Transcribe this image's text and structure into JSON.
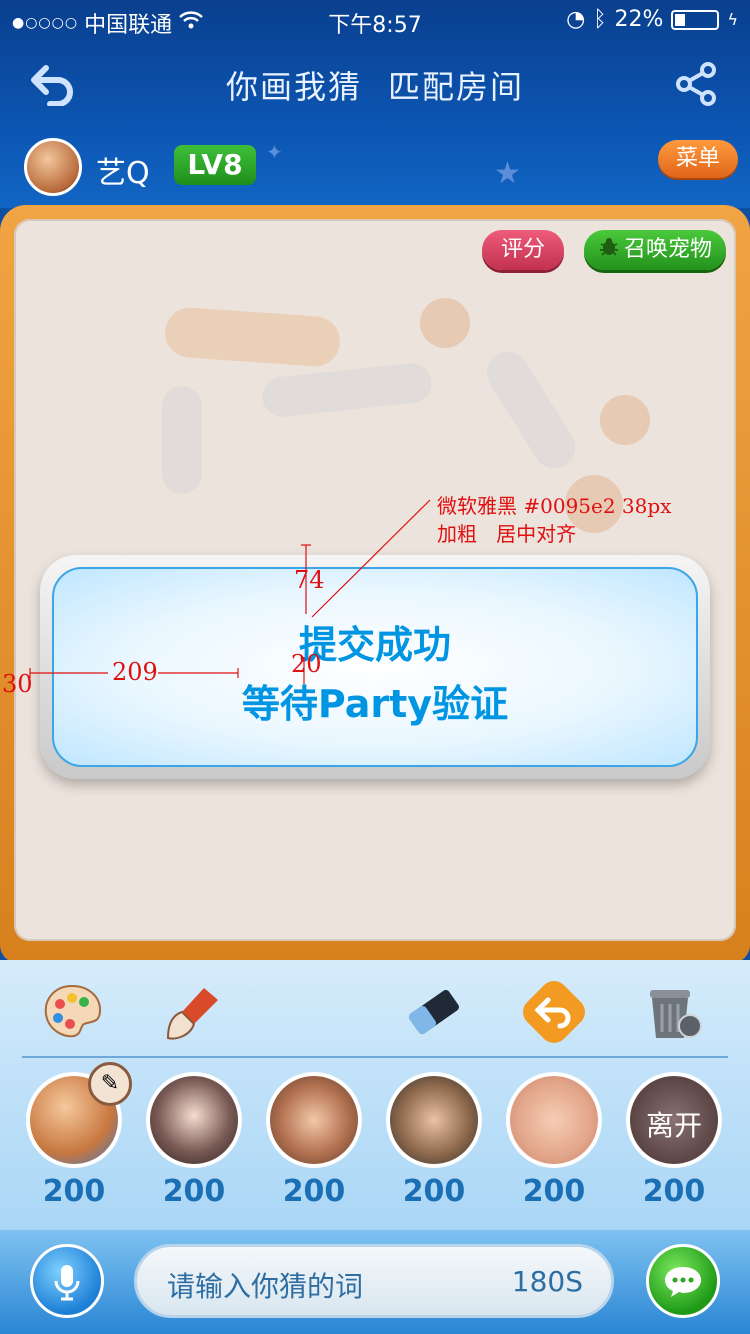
{
  "status_bar": {
    "signal_dots": "●○○○○",
    "carrier": "中国联通",
    "wifi_icon": "wifi-icon",
    "time": "下午8:57",
    "battery_percent": "22%",
    "battery_level": 0.22
  },
  "nav": {
    "title_part1": "你画我猜",
    "title_part2": "匹配房间",
    "back_icon": "back-arrow-icon",
    "share_icon": "share-icon"
  },
  "player": {
    "name": "艺Q",
    "level": "LV8",
    "menu_label": "菜单"
  },
  "board": {
    "rate_label": "评分",
    "pet_label": "召唤宠物",
    "pet_icon": "bug-icon"
  },
  "dialog": {
    "line1": "提交成功",
    "line2": "等待Party验证",
    "text_color": "#0095e2"
  },
  "annotations": {
    "font_note": "微软雅黑 #0095e2 38px\n加粗   居中对齐",
    "gap_top": "74",
    "gap_lines": "20",
    "left_inset": "30",
    "left_text_offset": "209"
  },
  "tools": [
    "palette-icon",
    "brush-icon",
    "eraser-icon",
    "undo-icon",
    "trash-icon"
  ],
  "players": [
    {
      "score": "200",
      "is_drawer": true
    },
    {
      "score": "200"
    },
    {
      "score": "200"
    },
    {
      "score": "200"
    },
    {
      "score": "200"
    },
    {
      "score": "200",
      "status": "离开"
    }
  ],
  "input": {
    "placeholder": "请输入你猜的词",
    "timer": "180S"
  }
}
